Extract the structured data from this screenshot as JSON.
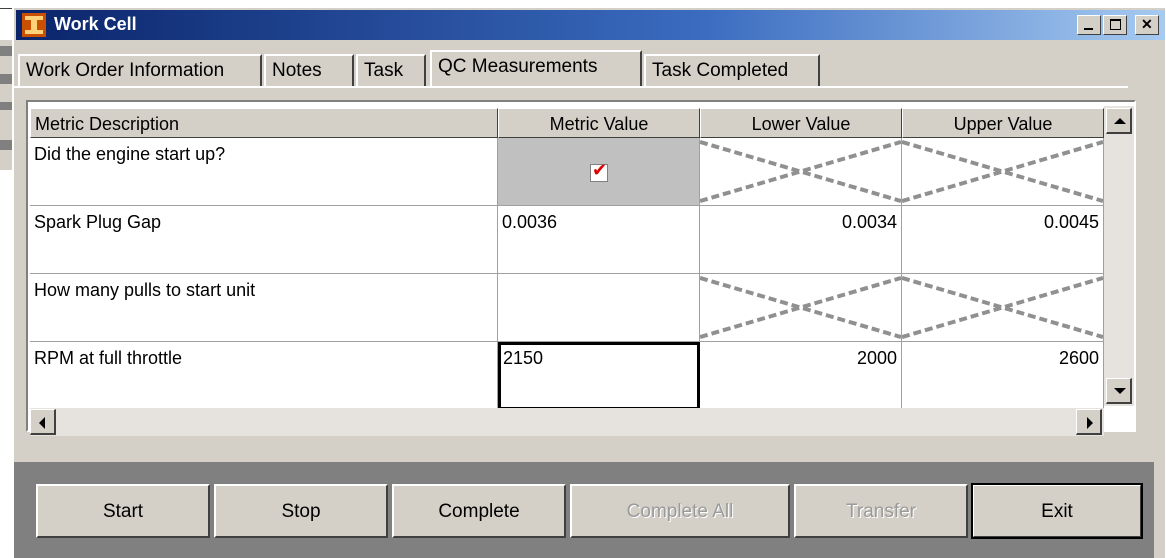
{
  "window": {
    "title": "Work Cell"
  },
  "tabs": [
    "Work Order Information",
    "Notes",
    "Task",
    "QC Measurements",
    "Task Completed"
  ],
  "active_tab": "QC Measurements",
  "grid": {
    "columns": [
      "Metric Description",
      "Metric Value",
      "Lower Value",
      "Upper Value"
    ],
    "rows": [
      {
        "description": "Did the engine start up?",
        "value": "",
        "lower": "",
        "upper": ""
      },
      {
        "description": "Spark Plug Gap",
        "value": "0.0036",
        "lower": "0.0034",
        "upper": "0.0045"
      },
      {
        "description": "How many pulls to start unit",
        "value": "",
        "lower": "",
        "upper": ""
      },
      {
        "description": "RPM at full throttle",
        "value": "2150",
        "lower": "2000",
        "upper": "2600"
      }
    ]
  },
  "buttons": {
    "start": "Start",
    "stop": "Stop",
    "complete": "Complete",
    "complete_all": "Complete All",
    "transfer": "Transfer",
    "exit": "Exit"
  },
  "colors": {
    "titlebar": "#0a246a",
    "check": "#e00000",
    "face": "#d4d0c8"
  }
}
